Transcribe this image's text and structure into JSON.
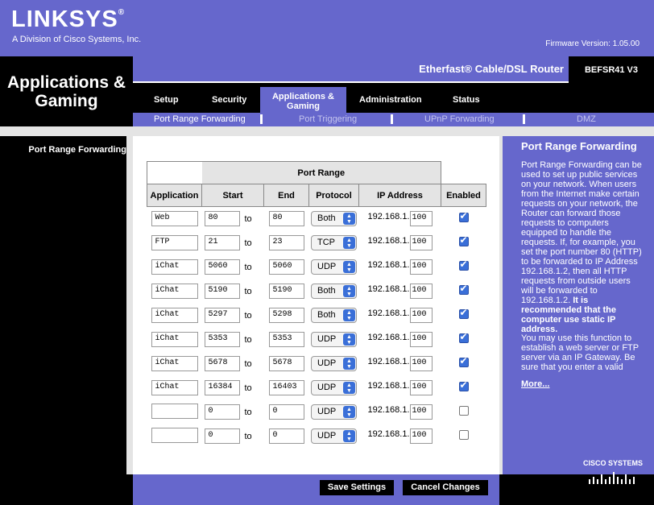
{
  "brand": {
    "logo": "LINKSYS",
    "reg": "®",
    "tagline": "A Division of Cisco Systems, Inc.",
    "firmware": "Firmware Version: 1.05.00"
  },
  "section_title": "Applications & Gaming",
  "product": {
    "name": "Etherfast® Cable/DSL Router",
    "model": "BEFSR41 V3"
  },
  "tabs": [
    {
      "label": "Setup"
    },
    {
      "label": "Security"
    },
    {
      "label": "Applications & Gaming"
    },
    {
      "label": "Administration"
    },
    {
      "label": "Status"
    }
  ],
  "subtabs": [
    {
      "label": "Port Range Forwarding"
    },
    {
      "label": "Port Triggering"
    },
    {
      "label": "UPnP Forwarding"
    },
    {
      "label": "DMZ"
    }
  ],
  "nav_item": "Port Range Forwarding",
  "table": {
    "group_header": "Port Range",
    "headers": [
      "Application",
      "Start",
      "End",
      "Protocol",
      "IP Address",
      "Enabled"
    ],
    "to_label": "to",
    "ip_prefix": "192.168.1.",
    "rows": [
      {
        "app": "Web",
        "start": "80",
        "end": "80",
        "protocol": "Both",
        "ip": "100",
        "enabled": true
      },
      {
        "app": "FTP",
        "start": "21",
        "end": "23",
        "protocol": "TCP",
        "ip": "100",
        "enabled": true
      },
      {
        "app": "iChat",
        "start": "5060",
        "end": "5060",
        "protocol": "UDP",
        "ip": "100",
        "enabled": true
      },
      {
        "app": "iChat",
        "start": "5190",
        "end": "5190",
        "protocol": "Both",
        "ip": "100",
        "enabled": true
      },
      {
        "app": "iChat",
        "start": "5297",
        "end": "5298",
        "protocol": "Both",
        "ip": "100",
        "enabled": true
      },
      {
        "app": "iChat",
        "start": "5353",
        "end": "5353",
        "protocol": "UDP",
        "ip": "100",
        "enabled": true
      },
      {
        "app": "iChat",
        "start": "5678",
        "end": "5678",
        "protocol": "UDP",
        "ip": "100",
        "enabled": true
      },
      {
        "app": "iChat",
        "start": "16384",
        "end": "16403",
        "protocol": "UDP",
        "ip": "100",
        "enabled": true
      },
      {
        "app": "",
        "start": "0",
        "end": "0",
        "protocol": "UDP",
        "ip": "100",
        "enabled": false
      },
      {
        "app": "",
        "start": "0",
        "end": "0",
        "protocol": "UDP",
        "ip": "100",
        "enabled": false
      }
    ]
  },
  "help": {
    "title": "Port Range Forwarding",
    "para1": "Port Range Forwarding can be used to set up public services on your network. When users from the Internet make certain requests on your network, the Router can forward those requests to computers equipped to handle the requests. If, for example, you set the port number 80 (HTTP) to be forwarded to IP Address 192.168.1.2, then all HTTP requests from outside users will be forwarded to 192.168.1.2.",
    "para1_bold": "It is recommended that the computer use static IP address.",
    "para2": "You may use this function to establish a web server or FTP server via an IP Gateway. Be sure that you enter a valid",
    "more": "More..."
  },
  "cisco_label": "Cisco Systems",
  "buttons": {
    "save": "Save Settings",
    "cancel": "Cancel Changes"
  },
  "colors": {
    "purple": "#6667cc",
    "black": "#000000",
    "gray": "#e4e4e4"
  }
}
